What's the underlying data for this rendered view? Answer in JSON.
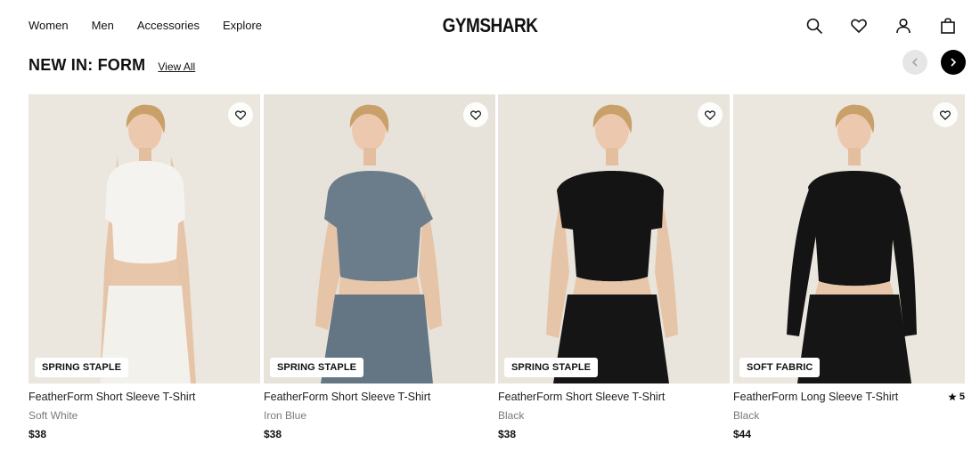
{
  "nav": {
    "items": [
      {
        "label": "Women"
      },
      {
        "label": "Men"
      },
      {
        "label": "Accessories"
      },
      {
        "label": "Explore"
      }
    ],
    "logo": "GYMSHARK",
    "icons": [
      "search-icon",
      "heart-icon",
      "account-icon",
      "bag-icon"
    ]
  },
  "section": {
    "title": "NEW IN: FORM",
    "view_all": "View All",
    "prev_icon": "chevron-left-icon",
    "next_icon": "chevron-right-icon"
  },
  "products": [
    {
      "name": "FeatherForm Short Sleeve T-Shirt",
      "color": "Soft White",
      "price": "$38",
      "badge": "SPRING STAPLE",
      "top_color": "#f4f3ef",
      "bottom_color": "#f2f1ec",
      "bg": "#ebe6de"
    },
    {
      "name": "FeatherForm Short Sleeve T-Shirt",
      "color": "Iron Blue",
      "price": "$38",
      "badge": "SPRING STAPLE",
      "top_color": "#6b7d8a",
      "bottom_color": "#647683",
      "bg": "#e8e3da"
    },
    {
      "name": "FeatherForm Short Sleeve T-Shirt",
      "color": "Black",
      "price": "$38",
      "badge": "SPRING STAPLE",
      "top_color": "#141414",
      "bottom_color": "#151515",
      "bg": "#e9e4dc"
    },
    {
      "name": "FeatherForm Long Sleeve T-Shirt",
      "color": "Black",
      "price": "$44",
      "badge": "SOFT FABRIC",
      "top_color": "#141414",
      "bottom_color": "#151515",
      "bg": "#ebe6de",
      "rating": "5"
    }
  ]
}
